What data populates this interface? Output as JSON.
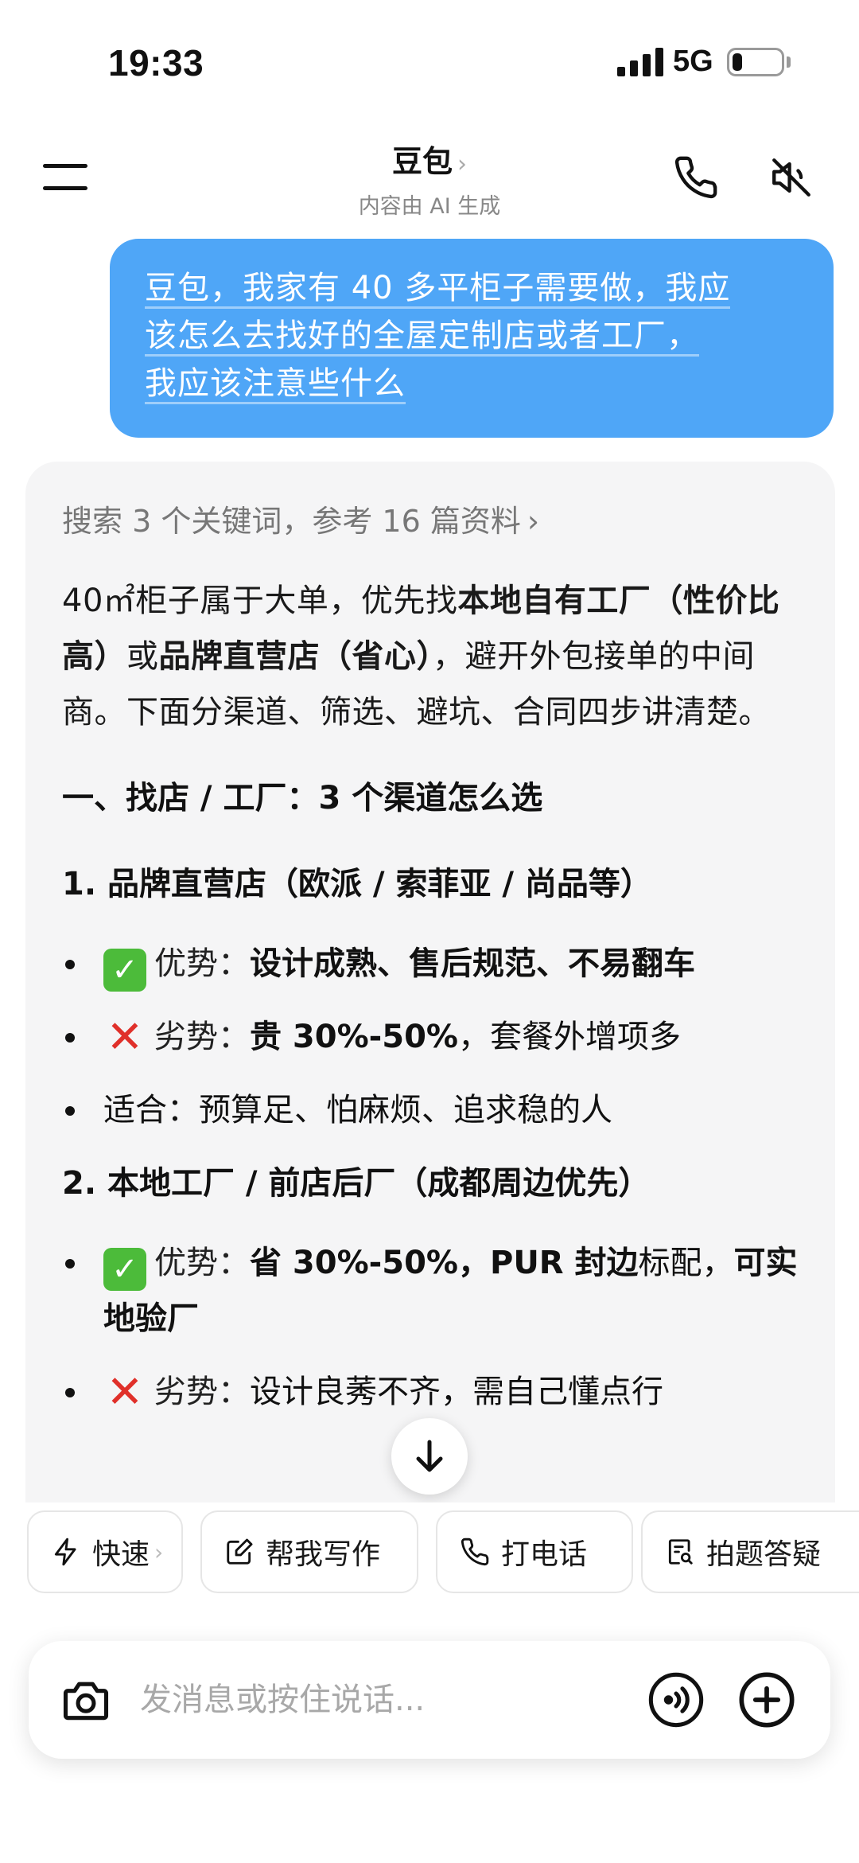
{
  "status_bar": {
    "time": "19:33",
    "network": "5G",
    "battery_level": 0.2
  },
  "header": {
    "title": "豆包",
    "title_chevron": "›",
    "subtitle": "内容由 AI 生成"
  },
  "user_message": {
    "lines": [
      "豆包，我家有 40 多平柜子需要做，我应",
      "该怎么去找好的全屋定制店或者工厂，",
      "我应该注意些什么"
    ]
  },
  "answer": {
    "search_ref": "搜索 3 个关键词，参考 16 篇资料",
    "search_chevron": "›",
    "intro": {
      "p1": "40㎡柜子属于大单，优先找",
      "b1": "本地自有工厂（性价比高）",
      "p2": "或",
      "b2": "品牌直营店（省心）",
      "p3": "，避开外包接单的中间商。下面分渠道、筛选、避坑、合同四步讲清楚。"
    },
    "section_title": "一、找店 / 工厂：3 个渠道怎么选",
    "sub1": {
      "title": "1. 品牌直营店（欧派 / 索菲亚 / 尚品等）",
      "pro_label": "优势：",
      "pro_text": "设计成熟、售后规范、不易翻车",
      "con_label": "劣势：",
      "con_bold": "贵 30%-50%",
      "con_text": "，套餐外增项多",
      "fit": "适合：预算足、怕麻烦、追求稳的人"
    },
    "sub2": {
      "title": "2. 本地工厂 / 前店后厂（成都周边优先）",
      "pro_label": "优势：",
      "pro_bold": "省 30%-50%，PUR 封边",
      "pro_text": "标配，",
      "pro_bold2": "可实地验厂",
      "con_label": "劣势：",
      "con_text": "设计良莠不齐，需自己懂点行"
    }
  },
  "quick_actions": [
    {
      "label": "快速",
      "icon": "lightning-icon",
      "chevron": "›"
    },
    {
      "label": "帮我写作",
      "icon": "edit-icon"
    },
    {
      "label": "打电话",
      "icon": "phone-icon"
    },
    {
      "label": "拍题答疑",
      "icon": "scan-question-icon"
    }
  ],
  "input": {
    "placeholder": "发消息或按住说话..."
  },
  "colors": {
    "accent": "#4fa6f7",
    "check": "#4cbb3a",
    "cross": "#e0302a"
  }
}
